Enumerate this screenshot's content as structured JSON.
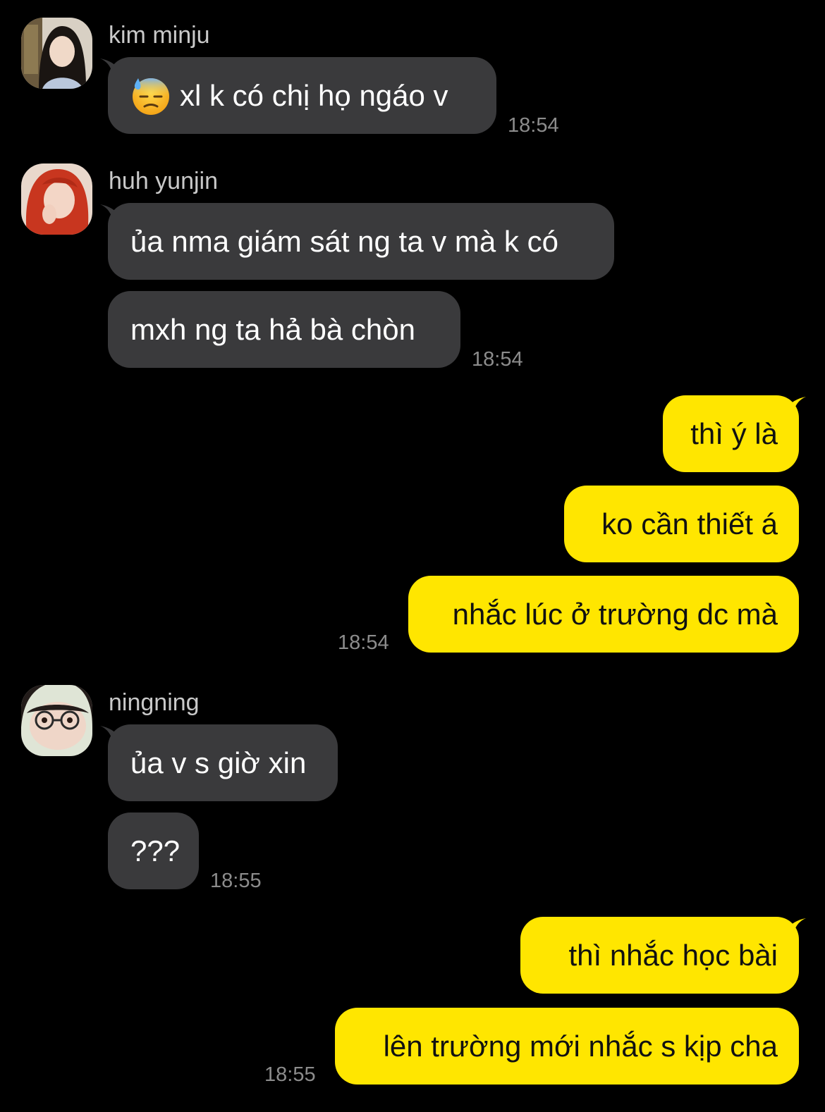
{
  "messages": [
    {
      "sender": "kim minju",
      "avatar": "avatar-kim-minju",
      "bubbles": [
        {
          "emoji": "downcast-face-with-sweat-icon",
          "text": "xl k có chị họ ngáo v"
        }
      ],
      "time": "18:54"
    },
    {
      "sender": "huh yunjin",
      "avatar": "avatar-huh-yunjin",
      "bubbles": [
        {
          "text": "ủa nma giám sát ng ta v mà k có"
        },
        {
          "text": "mxh ng ta hả bà chòn"
        }
      ],
      "time": "18:54"
    },
    {
      "sender": "me",
      "bubbles": [
        {
          "text": "thì ý là"
        },
        {
          "text": "ko cần thiết á"
        },
        {
          "text": "nhắc lúc ở trường dc mà"
        }
      ],
      "time": "18:54"
    },
    {
      "sender": "ningning",
      "avatar": "avatar-ningning",
      "bubbles": [
        {
          "text": "ủa v s giờ xin"
        },
        {
          "text": "???"
        }
      ],
      "time": "18:55"
    },
    {
      "sender": "me",
      "bubbles": [
        {
          "text": "thì nhắc học bài"
        },
        {
          "text": "lên trường mới nhắc s kịp cha"
        }
      ],
      "time": "18:55"
    }
  ],
  "colors": {
    "background": "#000000",
    "incoming_bubble": "#3a3a3c",
    "outgoing_bubble": "#ffe600",
    "timestamp": "#8c8c8c",
    "sender_name": "#c9c9c9"
  }
}
